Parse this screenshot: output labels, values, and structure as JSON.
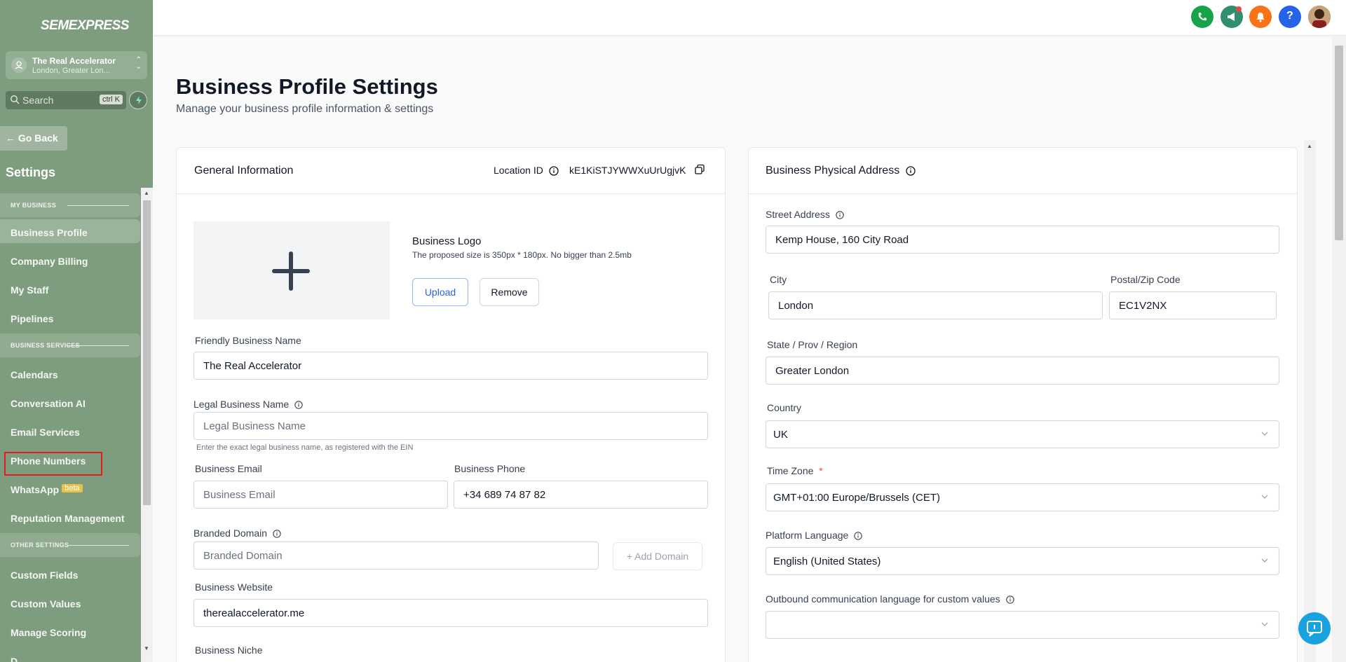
{
  "brand": {
    "logo_text": "SEMEXPRESS"
  },
  "location": {
    "name": "The Real Accelerator",
    "sub": "London, Greater Lon..."
  },
  "search": {
    "placeholder": "Search",
    "shortcut": "ctrl K"
  },
  "nav": {
    "go_back": "Go Back",
    "settings_title": "Settings",
    "sections": {
      "my_business": "MY BUSINESS",
      "business_services": "BUSINESS SERVICES",
      "other_settings": "OTHER SETTINGS"
    },
    "items": {
      "business_profile": "Business Profile",
      "company_billing": "Company Billing",
      "my_staff": "My Staff",
      "pipelines": "Pipelines",
      "calendars": "Calendars",
      "conversation_ai": "Conversation AI",
      "email_services": "Email Services",
      "phone_numbers": "Phone Numbers",
      "whatsapp": "WhatsApp",
      "whatsapp_badge": "beta",
      "reputation_management": "Reputation Management",
      "custom_fields": "Custom Fields",
      "custom_values": "Custom Values",
      "manage_scoring": "Manage Scoring",
      "partial_next": "D..."
    }
  },
  "topbar_colors": {
    "phone": "#16a34a",
    "announce": "#2f8f6f",
    "bell": "#f97316",
    "help": "#2563eb"
  },
  "page": {
    "title": "Business Profile Settings",
    "subtitle": "Manage your business profile information & settings"
  },
  "general": {
    "title": "General Information",
    "location_id_label": "Location ID",
    "location_id_value": "kE1KiSTJYWWXuUrUgjvK",
    "logo_label": "Business Logo",
    "logo_help": "The proposed size is 350px * 180px. No bigger than 2.5mb",
    "upload": "Upload",
    "remove": "Remove",
    "friendly_name_label": "Friendly Business Name",
    "friendly_name_value": "The Real Accelerator",
    "legal_name_label": "Legal Business Name",
    "legal_name_placeholder": "Legal Business Name",
    "legal_name_help": "Enter the exact legal business name, as registered with the EIN",
    "email_label": "Business Email",
    "email_placeholder": "Business Email",
    "phone_label": "Business Phone",
    "phone_value": "+34 689 74 87 82",
    "domain_label": "Branded Domain",
    "domain_placeholder": "Branded Domain",
    "add_domain": "Add Domain",
    "website_label": "Business Website",
    "website_value": "therealaccelerator.me",
    "niche_label": "Business Niche"
  },
  "address": {
    "title": "Business Physical Address",
    "street_label": "Street Address",
    "street_value": "Kemp House, 160 City Road",
    "city_label": "City",
    "city_value": "London",
    "zip_label": "Postal/Zip Code",
    "zip_value": "EC1V2NX",
    "state_label": "State / Prov / Region",
    "state_value": "Greater London",
    "country_label": "Country",
    "country_value": "UK",
    "timezone_label": "Time Zone",
    "timezone_required": "*",
    "timezone_value": "GMT+01:00 Europe/Brussels (CET)",
    "platform_lang_label": "Platform Language",
    "platform_lang_value": "English (United States)",
    "outbound_lang_label": "Outbound communication language for custom values",
    "outbound_lang_value": ""
  }
}
